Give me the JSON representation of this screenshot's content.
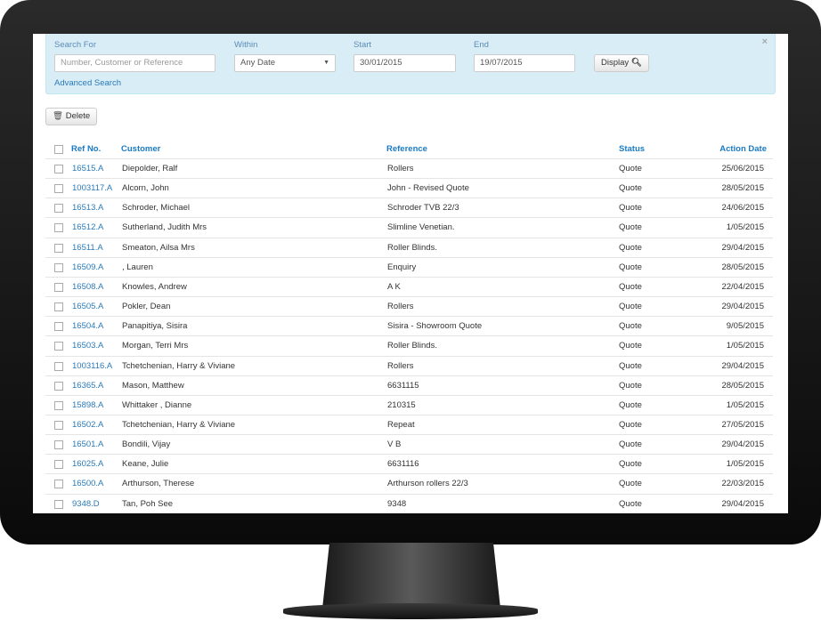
{
  "filter": {
    "search_label": "Search For",
    "search_placeholder": "Number, Customer or Reference",
    "within_label": "Within",
    "within_value": "Any Date",
    "start_label": "Start",
    "start_value": "30/01/2015",
    "end_label": "End",
    "end_value": "19/07/2015",
    "display_label": "Display",
    "advanced_label": "Advanced Search",
    "close_label": "×"
  },
  "toolbar": {
    "delete_label": "Delete"
  },
  "table": {
    "headers": {
      "ref": "Ref No.",
      "customer": "Customer",
      "reference": "Reference",
      "status": "Status",
      "date": "Action Date"
    },
    "rows": [
      {
        "ref": "16515.A",
        "customer": "Diepolder, Ralf",
        "reference": "Rollers",
        "status": "Quote",
        "date": "25/06/2015"
      },
      {
        "ref": "1003117.A",
        "customer": "Alcorn, John",
        "reference": "John - Revised Quote",
        "status": "Quote",
        "date": "28/05/2015"
      },
      {
        "ref": "16513.A",
        "customer": "Schroder, Michael",
        "reference": "Schroder TVB 22/3",
        "status": "Quote",
        "date": "24/06/2015"
      },
      {
        "ref": "16512.A",
        "customer": "Sutherland, Judith Mrs",
        "reference": "Slimline Venetian.",
        "status": "Quote",
        "date": "1/05/2015"
      },
      {
        "ref": "16511.A",
        "customer": "Smeaton, Ailsa Mrs",
        "reference": "Roller Blinds.",
        "status": "Quote",
        "date": "29/04/2015"
      },
      {
        "ref": "16509.A",
        "customer": ", Lauren",
        "reference": "Enquiry",
        "status": "Quote",
        "date": "28/05/2015"
      },
      {
        "ref": "16508.A",
        "customer": "Knowles, Andrew",
        "reference": "A K",
        "status": "Quote",
        "date": "22/04/2015"
      },
      {
        "ref": "16505.A",
        "customer": "Pokler, Dean",
        "reference": "Rollers",
        "status": "Quote",
        "date": "29/04/2015"
      },
      {
        "ref": "16504.A",
        "customer": "Panapitiya, Sisira",
        "reference": "Sisira - Showroom Quote",
        "status": "Quote",
        "date": "9/05/2015"
      },
      {
        "ref": "16503.A",
        "customer": "Morgan, Terri Mrs",
        "reference": "Roller Blinds.",
        "status": "Quote",
        "date": "1/05/2015"
      },
      {
        "ref": "1003116.A",
        "customer": "Tchetchenian, Harry & Viviane",
        "reference": "Rollers",
        "status": "Quote",
        "date": "29/04/2015"
      },
      {
        "ref": "16365.A",
        "customer": "Mason, Matthew",
        "reference": "6631115",
        "status": "Quote",
        "date": "28/05/2015"
      },
      {
        "ref": "15898.A",
        "customer": "Whittaker , Dianne",
        "reference": "210315",
        "status": "Quote",
        "date": "1/05/2015"
      },
      {
        "ref": "16502.A",
        "customer": "Tchetchenian, Harry & Viviane",
        "reference": "Repeat",
        "status": "Quote",
        "date": "27/05/2015"
      },
      {
        "ref": "16501.A",
        "customer": "Bondili, Vijay",
        "reference": "V B",
        "status": "Quote",
        "date": "29/04/2015"
      },
      {
        "ref": "16025.A",
        "customer": "Keane, Julie",
        "reference": "6631116",
        "status": "Quote",
        "date": "1/05/2015"
      },
      {
        "ref": "16500.A",
        "customer": "Arthurson, Therese",
        "reference": "Arthurson rollers 22/3",
        "status": "Quote",
        "date": "22/03/2015"
      },
      {
        "ref": "9348.D",
        "customer": "Tan, Poh See",
        "reference": "9348",
        "status": "Quote",
        "date": "29/04/2015"
      }
    ]
  }
}
